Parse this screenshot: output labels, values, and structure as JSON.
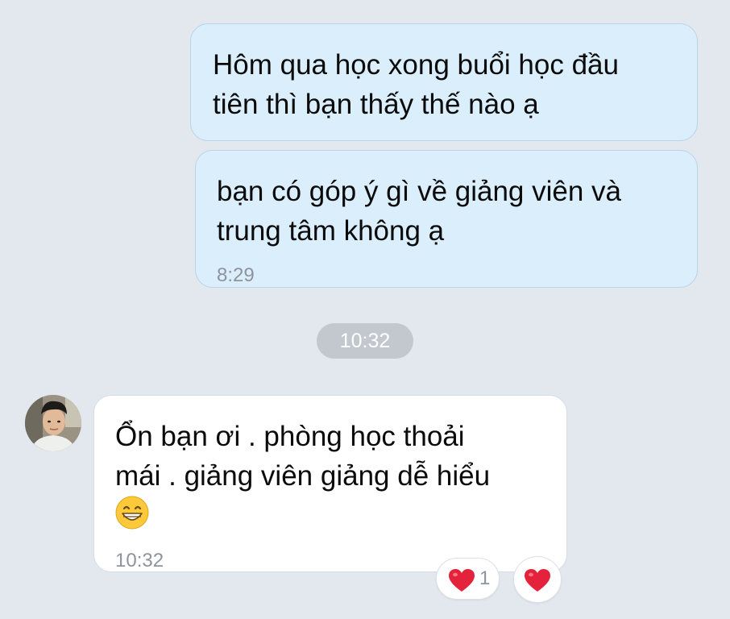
{
  "messages": [
    {
      "direction": "outgoing",
      "lines": [
        "Hôm qua học xong buổi học đầu",
        "tiên thì bạn thấy thế nào ạ"
      ],
      "time": ""
    },
    {
      "direction": "outgoing",
      "lines": [
        "bạn có góp ý gì về giảng viên và",
        "trung tâm không ạ"
      ],
      "time": "8:29"
    },
    {
      "direction": "incoming",
      "lines": [
        "Ổn bạn ơi . phòng học thoải",
        "mái . giảng viên giảng dễ hiểu"
      ],
      "emoji": "grinning-face-icon",
      "time": "10:32"
    }
  ],
  "time_divider": "10:32",
  "reactions": {
    "heart_count": "1",
    "heart_icon": "heart-icon",
    "add_reaction_icon": "heart-icon"
  },
  "colors": {
    "background": "#e3e7ee",
    "outgoing_bubble": "#dbeefc",
    "incoming_bubble": "#ffffff",
    "heart": "#e5223b"
  }
}
